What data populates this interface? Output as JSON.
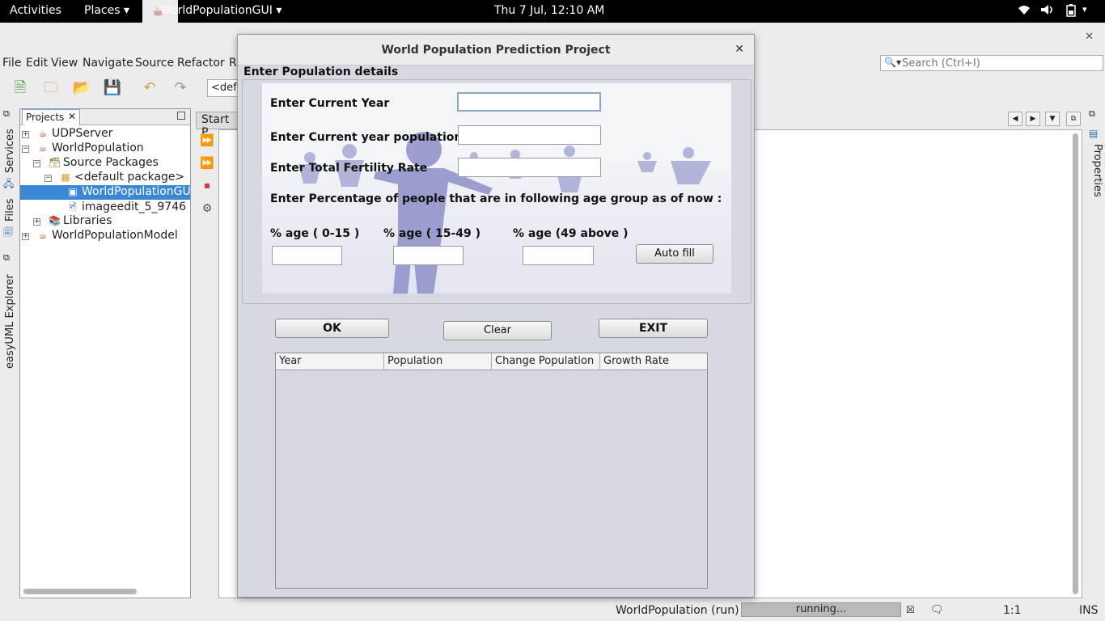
{
  "topbar": {
    "activities": "Activities",
    "places": "Places ▾",
    "app_name": "WorldPopulationGUI ▾",
    "datetime": "Thu  7 Jul, 12:10 AM",
    "icons": [
      "wifi-icon",
      "volume-icon",
      "battery-icon"
    ]
  },
  "ide": {
    "menu": [
      "File",
      "Edit",
      "View",
      "Navigate",
      "Source",
      "Refactor",
      "R"
    ],
    "search_placeholder": "Search (Ctrl+I)",
    "config_value": "<defa",
    "left_tabs": [
      "Services",
      "Files",
      "easyUML Explorer"
    ],
    "right_tabs": [
      "Properties"
    ],
    "projects_tab": "Projects",
    "editor_tab": "Start P",
    "tree": [
      {
        "label": "UDPServer",
        "expander": "+",
        "icon": "java-project-icon"
      },
      {
        "label": "WorldPopulation",
        "expander": "−",
        "icon": "java-project-icon"
      },
      {
        "label": "Source Packages",
        "expander": "−",
        "icon": "source-packages-icon"
      },
      {
        "label": "<default package>",
        "expander": "−",
        "icon": "package-icon"
      },
      {
        "label": "WorldPopulationGUI",
        "expander": "",
        "icon": "java-file-icon",
        "selected": true
      },
      {
        "label": "imageedit_5_9746",
        "expander": "",
        "icon": "image-file-icon"
      },
      {
        "label": "Libraries",
        "expander": "+",
        "icon": "libraries-icon"
      },
      {
        "label": "WorldPopulationModel",
        "expander": "+",
        "icon": "java-project-icon"
      }
    ],
    "status": {
      "run_label": "WorldPopulation (run)",
      "progress_text": "running...",
      "position": "1:1",
      "mode": "INS"
    }
  },
  "dialog": {
    "title": "World Population Prediction Project",
    "panel_title": "Enter Population details",
    "labels": {
      "current_year": "Enter Current Year",
      "current_population": "Enter Current year population",
      "fertility_rate": "Enter Total Fertility Rate",
      "percentage_prompt": "Enter Percentage of people that are in following age group as of now  :",
      "age_0_15": "% age ( 0-15 )",
      "age_15_49": "% age ( 15-49 )",
      "age_49_above": "% age (49 above )"
    },
    "values": {
      "current_year": "",
      "current_population": "",
      "fertility_rate": "",
      "age_0_15": "",
      "age_15_49": "",
      "age_49_above": ""
    },
    "buttons": {
      "auto_fill": "Auto fill",
      "ok": "OK",
      "clear": "Clear",
      "exit": "EXIT"
    },
    "table": {
      "columns": [
        "Year",
        "Population",
        "Change Population",
        "Growth Rate"
      ],
      "rows": []
    }
  }
}
